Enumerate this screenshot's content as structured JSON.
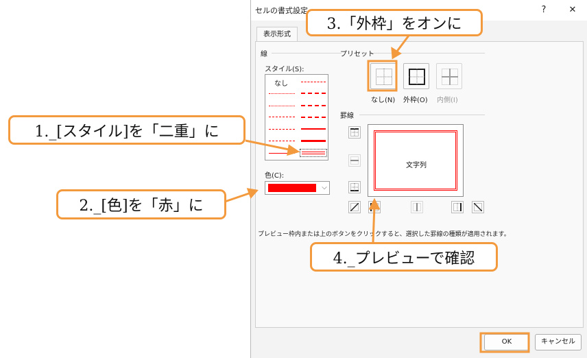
{
  "dialog": {
    "title": "セルの書式設定",
    "help_glyph": "?",
    "close_glyph": "✕",
    "tabs": [
      {
        "label": "表示形式"
      }
    ],
    "line_section": {
      "label": "線",
      "style_label": "スタイル(S):",
      "none_label": "なし",
      "color_label": "色(C):",
      "color_value": "#ff0000"
    },
    "preset_section": {
      "label": "プリセット",
      "none_label": "なし(N)",
      "outline_label": "外枠(O)",
      "inside_label": "内側(I)"
    },
    "border_section": {
      "label": "罫線",
      "preview_text": "文字列"
    },
    "hint_text": "プレビュー枠内または上のボタンをクリックすると、選択した罫線の種類が適用されます。",
    "ok_label": "OK",
    "cancel_label": "キャンセル"
  },
  "callouts": {
    "step1": "1._[スタイル]を「二重」に",
    "step2": "2._[色]を「赤」に",
    "step3": "3.「外枠」をオンに",
    "step4": "4._プレビューで確認"
  },
  "colors": {
    "accent_orange": "#f39a3e",
    "line_red": "#ff0000"
  }
}
